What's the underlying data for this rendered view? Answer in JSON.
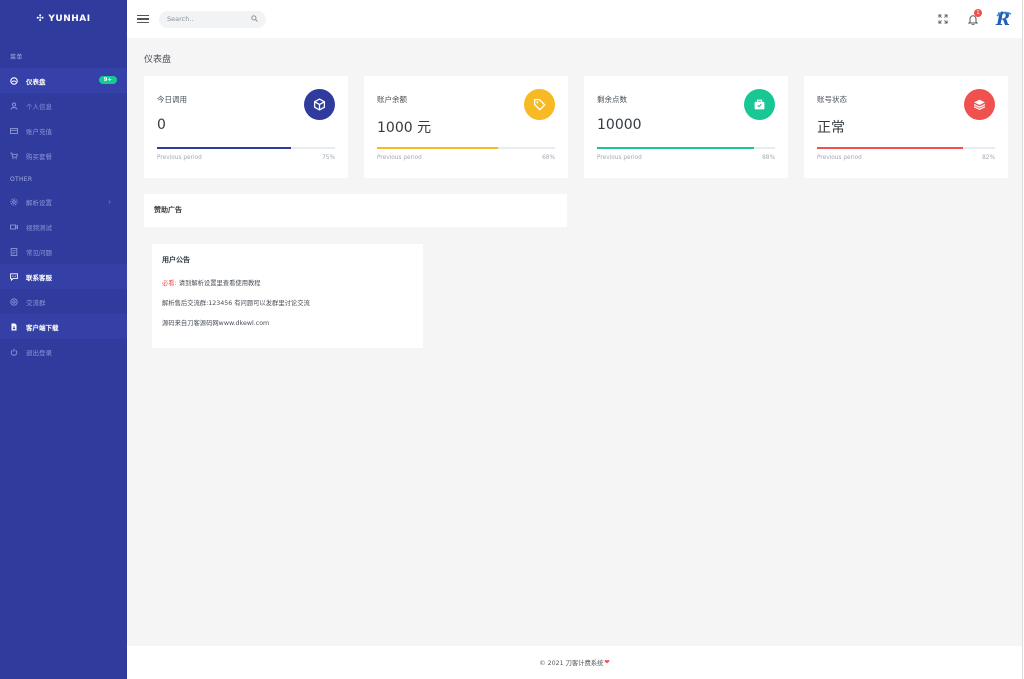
{
  "brand": {
    "logo_glyph": "✣",
    "name": "YUNHAI"
  },
  "sidebar": {
    "section_menu": "菜单",
    "section_other": "OTHER",
    "items": [
      {
        "label": "仪表盘",
        "icon": "dashboard-icon",
        "badge": "9+"
      },
      {
        "label": "个人信息",
        "icon": "user-icon"
      },
      {
        "label": "账户充值",
        "icon": "card-icon"
      },
      {
        "label": "购买套餐",
        "icon": "cart-icon"
      },
      {
        "label": "解析设置",
        "icon": "gear-icon"
      },
      {
        "label": "视频测试",
        "icon": "video-icon"
      },
      {
        "label": "常见问题",
        "icon": "document-icon"
      },
      {
        "label": "联系客服",
        "icon": "chat-icon"
      },
      {
        "label": "交流群",
        "icon": "group-icon"
      },
      {
        "label": "客户端下载",
        "icon": "download-icon"
      },
      {
        "label": "退出登录",
        "icon": "power-icon"
      }
    ]
  },
  "header": {
    "search_placeholder": "Search..",
    "notification_count": "1"
  },
  "page_title": "仪表盘",
  "stats": [
    {
      "label": "今日调用",
      "value": "0",
      "percent": 75,
      "percent_label": "75%",
      "footer": "Previous period",
      "color": "#2f3b9d",
      "icon": "cube-icon"
    },
    {
      "label": "账户余额",
      "value": "1000 元",
      "percent": 68,
      "percent_label": "68%",
      "footer": "Previous period",
      "color": "#f7b924",
      "icon": "tag-icon"
    },
    {
      "label": "剩余点数",
      "value": "10000",
      "percent": 88,
      "percent_label": "88%",
      "footer": "Previous period",
      "color": "#19c795",
      "icon": "briefcase-icon"
    },
    {
      "label": "账号状态",
      "value": "正常",
      "percent": 82,
      "percent_label": "82%",
      "footer": "Previous period",
      "color": "#f0514e",
      "icon": "layers-icon"
    }
  ],
  "ad": {
    "title": "赞助广告"
  },
  "notice": {
    "title": "用户公告",
    "line1_prefix": "必看:",
    "line1_text": " 请到解析设置里查看使用教程",
    "line2": "解析售后交流群:123456 有问题可以发群里讨论交流",
    "line3": "源码来自刀客源码网www.dkewl.com"
  },
  "footer": {
    "text": "© 2021 刀客计费系统",
    "heart": "❤"
  }
}
